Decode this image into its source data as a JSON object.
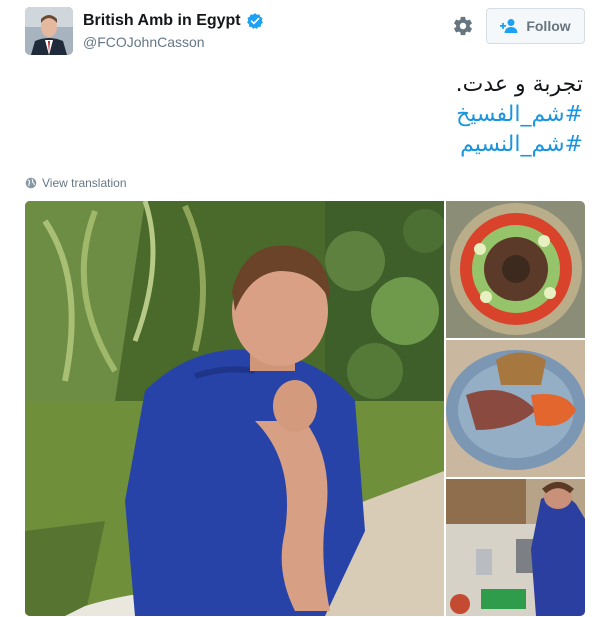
{
  "author": {
    "name": "British Amb in Egypt",
    "handle": "@FCOJohnCasson",
    "verified": true
  },
  "actions": {
    "follow_label": "Follow",
    "settings_icon": "gear-icon",
    "follow_icon": "add-user-icon"
  },
  "tweet": {
    "text_line": "تجربة و عدت.",
    "hashtags": [
      "#شم_الفسيخ",
      "#شم_النسيم"
    ]
  },
  "translate": {
    "label": "View translation",
    "icon": "globe-icon"
  },
  "colors": {
    "link": "#1b95e0",
    "verified": "#1da1f2",
    "secondary_text": "#657786"
  }
}
